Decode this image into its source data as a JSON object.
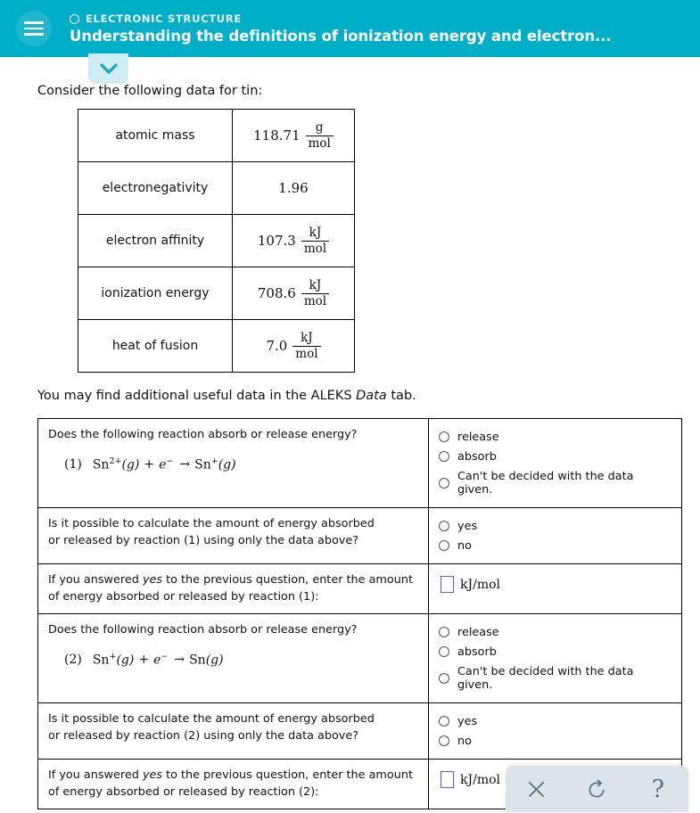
{
  "header": {
    "menu_icon": "hamburger-menu-icon",
    "eyebrow_icon": "circle-outline-icon",
    "eyebrow": "ELECTRONIC STRUCTURE",
    "title": "Understanding the definitions of ionization energy and electron...",
    "bg_color": "#00AEC7"
  },
  "chevron_tab": {
    "icon": "chevron-down-icon",
    "bg_color": "#cdeef4",
    "icon_color": "#1aa7bf"
  },
  "intro_text": "Consider the following data for tin:",
  "data_table": {
    "rows": [
      {
        "label": "atomic mass",
        "value": "118.71",
        "num": "g",
        "den": "mol"
      },
      {
        "label": "electronegativity",
        "value": "1.96",
        "num": "",
        "den": ""
      },
      {
        "label": "electron affinity",
        "value": "107.3",
        "num": "kJ",
        "den": "mol"
      },
      {
        "label": "ionization energy",
        "value": "708.6",
        "num": "kJ",
        "den": "mol"
      },
      {
        "label": "heat of fusion",
        "value": "7.0",
        "num": "kJ",
        "den": "mol"
      }
    ]
  },
  "aleks_note": {
    "before": "You may find additional useful data in the ALEKS ",
    "italic": "Data",
    "after": " tab."
  },
  "questions": {
    "r1_absorb_release": {
      "prompt": "Does the following reaction absorb or release energy?",
      "equation": {
        "label": "(1)",
        "reactant1": "Sn",
        "reactant1_charge": "2+",
        "reactant1_state": "(g)",
        "plus": "+",
        "electron": "e",
        "electron_charge": "−",
        "arrow": "→",
        "product": "Sn",
        "product_charge": "+",
        "product_state": "(g)"
      },
      "options": [
        "release",
        "absorb",
        "Can't be decided with the data given."
      ]
    },
    "r1_possible": {
      "prompt_line1": "Is it possible to calculate the amount of energy absorbed",
      "prompt_line2": "or released by reaction (1) using only the data above?",
      "options": [
        "yes",
        "no"
      ]
    },
    "r1_amount": {
      "prompt_before": "If you answered ",
      "prompt_italic": "yes",
      "prompt_after": " to the previous question, enter the amount of energy absorbed or released by reaction (1):",
      "input_value": "",
      "unit": "kJ/mol"
    },
    "r2_absorb_release": {
      "prompt": "Does the following reaction absorb or release energy?",
      "equation": {
        "label": "(2)",
        "reactant1": "Sn",
        "reactant1_charge": "+",
        "reactant1_state": "(g)",
        "plus": "+",
        "electron": "e",
        "electron_charge": "−",
        "arrow": "→",
        "product": "Sn",
        "product_charge": "",
        "product_state": "(g)"
      },
      "options": [
        "release",
        "absorb",
        "Can't be decided with the data given."
      ]
    },
    "r2_possible": {
      "prompt_line1": "Is it possible to calculate the amount of energy absorbed",
      "prompt_line2": "or released by reaction (2) using only the data above?",
      "options": [
        "yes",
        "no"
      ]
    },
    "r2_amount": {
      "prompt_before": "If you answered ",
      "prompt_italic": "yes",
      "prompt_after": " to the previous question, enter the amount of energy absorbed or released by reaction (2):",
      "input_value": "",
      "unit": "kJ/mol"
    }
  },
  "toolbar": {
    "close_icon": "close-x-icon",
    "undo_icon": "undo-rotate-ccw-icon",
    "help_icon": "question-mark-icon",
    "help_label": "?",
    "bg_color": "#dde4e9",
    "icon_color": "#5c7484"
  }
}
